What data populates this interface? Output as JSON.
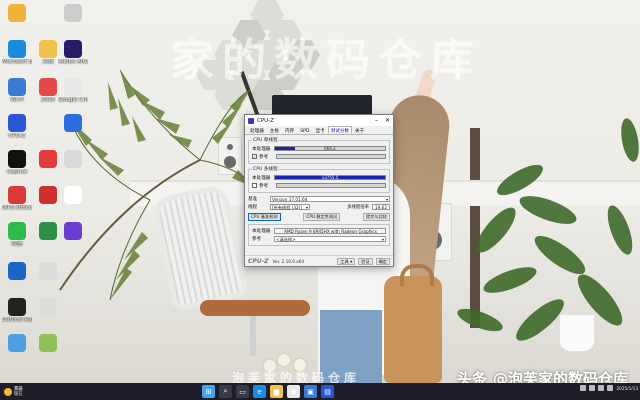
{
  "watermark": {
    "top": "家的数码仓库",
    "bottom": "泡芙家的数码仓库",
    "brand_prefix": "头条",
    "brand": "@泡芙家的数码仓库"
  },
  "desktop_icons": [
    {
      "label": "",
      "color": "#f0b23a",
      "icon": "file-icon"
    },
    {
      "label": "",
      "color": "#cccccc",
      "icon": "document-icon"
    },
    {
      "label": "Microsoft Edge",
      "color": "#1b8be0",
      "icon": "edge-icon"
    },
    {
      "label": "文档",
      "color": "#f0c24a",
      "icon": "folder-icon"
    },
    {
      "label": "Adobe After Effects 2025",
      "color": "#2a1b66",
      "icon": "after-effects-icon"
    },
    {
      "label": "Wi-Fi",
      "color": "#3a7bd5",
      "icon": "wifi-icon"
    },
    {
      "label": "2025",
      "color": "#e24a4a",
      "icon": "media-icon"
    },
    {
      "label": "Google Chrome",
      "color": "#e8e8e8",
      "icon": "chrome-icon"
    },
    {
      "label": "CPU-Z",
      "color": "#2b57d6",
      "icon": "cpuz-icon"
    },
    {
      "label": "",
      "color": "#2d6fe0",
      "icon": "app-icon"
    },
    {
      "label": "CapCut",
      "color": "#111111",
      "icon": "capcut-icon"
    },
    {
      "label": "",
      "color": "#e03c3c",
      "icon": "app-icon"
    },
    {
      "label": "",
      "color": "#d9d9d9",
      "icon": "document-icon"
    },
    {
      "label": "WPS Office",
      "color": "#d93a3a",
      "icon": "wps-icon"
    },
    {
      "label": "",
      "color": "#cf2e2e",
      "icon": "app-icon"
    },
    {
      "label": "",
      "color": "#ffffff",
      "icon": "document-icon"
    },
    {
      "label": "微信",
      "color": "#2dbb4e",
      "icon": "wechat-icon"
    },
    {
      "label": "",
      "color": "#2f8f47",
      "icon": "app-icon"
    },
    {
      "label": "",
      "color": "#6a3fd0",
      "icon": "app-icon"
    },
    {
      "label": "",
      "color": "#1e63c6",
      "icon": "app-icon"
    },
    {
      "label": "",
      "color": "#dddddd",
      "icon": "document-icon"
    },
    {
      "label": "DaVinci Resolve",
      "color": "#222222",
      "icon": "davinci-icon"
    },
    {
      "label": "",
      "color": "#dddddd",
      "icon": "document-icon"
    },
    {
      "label": "",
      "color": "#4aa0e0",
      "icon": "app-icon"
    },
    {
      "label": "",
      "color": "#8fc05a",
      "icon": "app-icon"
    }
  ],
  "cpuz": {
    "title": "CPU-Z",
    "tabs": [
      "处理器",
      "主板",
      "内存",
      "SPD",
      "显卡",
      "测试分数",
      "关于"
    ],
    "active_tab": 5,
    "single": {
      "legend": "CPU 单线程",
      "this_label": "本处理器",
      "this_value": "666.2",
      "this_fill": 0.18,
      "ref_label": "参考",
      "ref_fill": 0
    },
    "multi": {
      "legend": "CPU 多线程",
      "this_label": "本处理器",
      "this_value": "13755.5",
      "this_fill": 1.0,
      "ref_label": "参考",
      "ref_fill": 0
    },
    "benchmark_label": "基准",
    "benchmark_value": "Version 17.01.64",
    "threads_label": "线程",
    "threads_value": "[所有线程 (32)]",
    "ratio_label": "多线程倍率",
    "ratio_value": "19.62",
    "buttons": [
      "CPU 基准检测",
      "CPU 稳定性测试",
      "提交与比较"
    ],
    "this_cpu_label": "本处理器",
    "this_cpu_value": "AMD Ryzen 9 8945HX with Radeon Graphics",
    "reference_label": "参考",
    "reference_value": "<请选择>",
    "footer_logo": "CPU-Z",
    "version": "Ver. 2.16.0.x64",
    "tools_label": "工具",
    "validate_label": "验证",
    "ok_label": "确定"
  },
  "taskbar": {
    "weather_line1": "雾霾",
    "weather_line2": "现在",
    "apps": [
      {
        "icon": "windows-start-icon",
        "color": "#4aa3f0",
        "glyph": "⊞"
      },
      {
        "icon": "search-icon",
        "color": "#3a3a4a",
        "glyph": "⌕"
      },
      {
        "icon": "task-view-icon",
        "color": "#3a3a4a",
        "glyph": "▭"
      },
      {
        "icon": "edge-icon",
        "color": "#1b8be0",
        "glyph": "e"
      },
      {
        "icon": "explorer-icon",
        "color": "#f0c24a",
        "glyph": "▆"
      },
      {
        "icon": "chrome-icon",
        "color": "#e8e8e8",
        "glyph": "◉"
      },
      {
        "icon": "store-icon",
        "color": "#3a7bd5",
        "glyph": "▣"
      },
      {
        "icon": "cpuz-icon",
        "color": "#2b57d6",
        "glyph": "▤"
      }
    ],
    "clock_date": "2025/1/13"
  }
}
